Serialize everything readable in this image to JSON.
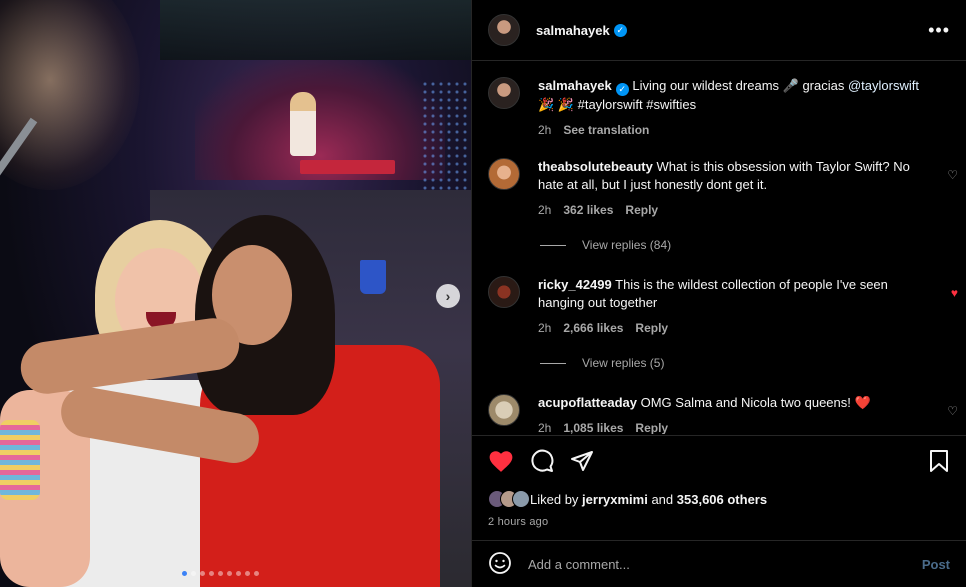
{
  "post": {
    "author": "salmahayek",
    "caption_text": "Living our wildest dreams 🎤 gracias",
    "caption_mention": "@taylorswift",
    "caption_tags": "🎉 🎉 #taylorswift #swifties",
    "caption_time": "2h",
    "see_translation": "See translation",
    "carousel_total": 9,
    "carousel_active": 0
  },
  "comments": [
    {
      "user": "theabsolutebeauty",
      "text": "What is this obsession with Taylor Swift? No hate at all, but I just honestly dont get it.",
      "time": "2h",
      "likes": "362 likes",
      "reply": "Reply",
      "replies": "View replies (84)",
      "liked": false
    },
    {
      "user": "ricky_42499",
      "text": "This is the wildest collection of people I've seen hanging out together",
      "time": "2h",
      "likes": "2,666 likes",
      "reply": "Reply",
      "replies": "View replies (5)",
      "liked": true
    },
    {
      "user": "acupoflatteaday",
      "text": "OMG Salma and Nicola two queens! ❤️",
      "time": "2h",
      "likes": "1,085 likes",
      "reply": "Reply",
      "liked": false
    }
  ],
  "likes": {
    "prefix": "Liked by",
    "user": "jerryxmimi",
    "middle": "and",
    "count": "353,606 others"
  },
  "timestamp": "2 hours ago",
  "add_comment": {
    "placeholder": "Add a comment...",
    "post_label": "Post"
  },
  "icons": {
    "more": "more-options-icon",
    "like": "heart-icon",
    "comment": "comment-icon",
    "share": "share-icon",
    "save": "bookmark-icon",
    "emoji": "emoji-icon",
    "next": "chevron-right-icon"
  },
  "colors": {
    "verified": "#0095f6",
    "liked_heart": "#ff3040",
    "background": "#000000",
    "divider": "#262626",
    "muted_text": "#a8a8a8"
  }
}
